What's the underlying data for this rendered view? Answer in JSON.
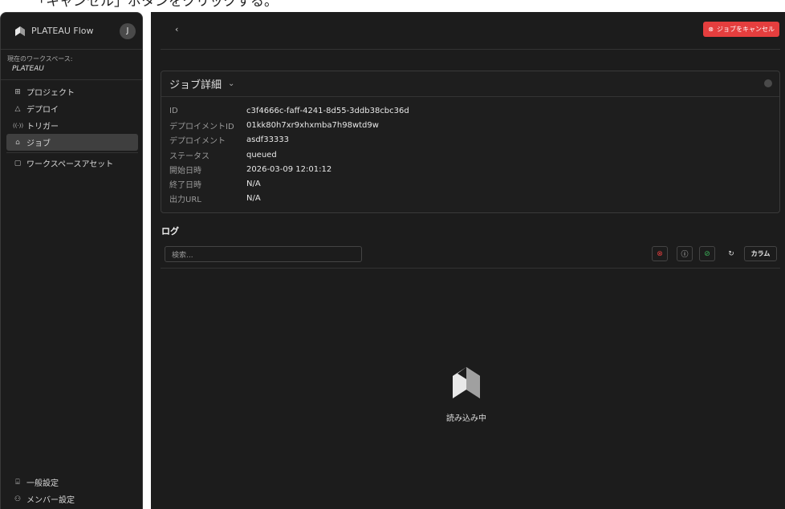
{
  "caption": "「キャンセル」ボタンをクリックする。",
  "sidebar": {
    "app_title": "PLATEAU Flow",
    "avatar_initial": "J",
    "workspace_label": "現在のワークスペース:",
    "workspace_name": "PLATEAU",
    "nav": [
      {
        "icon": "projects-grid-icon",
        "glyph": "⊞",
        "label": "プロジェクト"
      },
      {
        "icon": "deploy-triangle-icon",
        "glyph": "△",
        "label": "デプロイ"
      },
      {
        "icon": "trigger-broadcast-icon",
        "glyph": "((·))",
        "label": "トリガー"
      },
      {
        "icon": "job-icon",
        "glyph": "⌂",
        "label": "ジョブ",
        "active": true
      },
      {
        "icon": "file-icon",
        "glyph": "▢",
        "label": "ワークスペースアセット"
      }
    ],
    "bottom": [
      {
        "icon": "general-settings-icon",
        "glyph": "⌸",
        "label": "一般設定"
      },
      {
        "icon": "member-settings-icon",
        "glyph": "⚇",
        "label": "メンバー設定"
      }
    ]
  },
  "topbar": {
    "back_glyph": "‹",
    "cancel_label": "ジョブをキャンセル",
    "cancel_glyph": "⊗"
  },
  "job_details": {
    "title": "ジョブ詳細",
    "chevron": "⌄",
    "rows": [
      {
        "key": "ID",
        "value": "c3f4666c-faff-4241-8d55-3ddb38cbc36d"
      },
      {
        "key": "デプロイメントID",
        "value": "01kk80h7xr9xhxmba7h98wtd9w"
      },
      {
        "key": "デプロイメント",
        "value": "asdf33333"
      },
      {
        "key": "ステータス",
        "value": "queued"
      },
      {
        "key": "開始日時",
        "value": "2026-03-09 12:01:12"
      },
      {
        "key": "終了日時",
        "value": "N/A"
      },
      {
        "key": "出力URL",
        "value": "N/A"
      }
    ]
  },
  "logs": {
    "title": "ログ",
    "search_placeholder": "検索...",
    "filter_error_glyph": "⊗",
    "filter_info_glyph": "ⓘ",
    "filter_success_glyph": "⊘",
    "refresh_glyph": "↻",
    "columns_label": "カラム",
    "loading_text": "読み込み中"
  },
  "colors": {
    "background": "#1c1c1c",
    "accent_danger": "#e53e3e",
    "success": "#3cb35a"
  }
}
